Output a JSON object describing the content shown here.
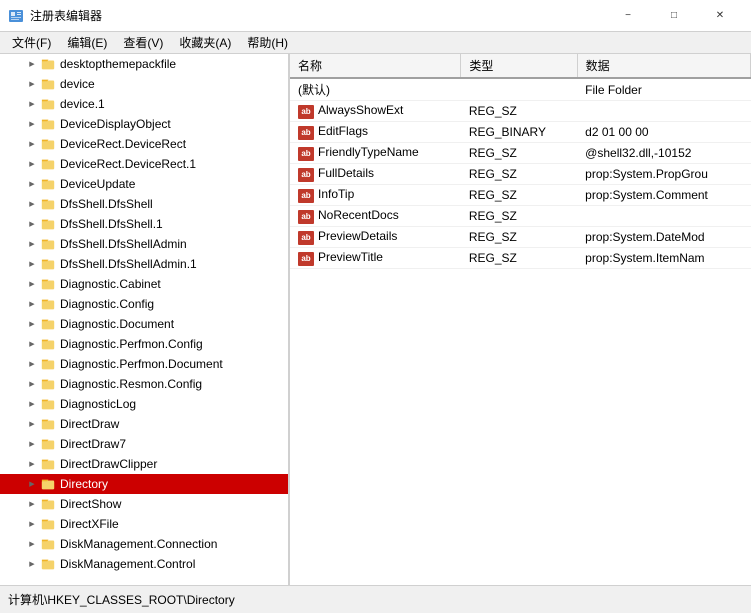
{
  "window": {
    "title": "注册表编辑器",
    "icon": "regedit-icon"
  },
  "menu": {
    "items": [
      {
        "label": "文件(F)"
      },
      {
        "label": "编辑(E)"
      },
      {
        "label": "查看(V)"
      },
      {
        "label": "收藏夹(A)"
      },
      {
        "label": "帮助(H)"
      }
    ]
  },
  "tree": {
    "items": [
      {
        "id": "desktopthemepackfile",
        "label": "desktopthemepackfile",
        "indent": 1,
        "expanded": false
      },
      {
        "id": "device",
        "label": "device",
        "indent": 1,
        "expanded": false
      },
      {
        "id": "device1",
        "label": "device.1",
        "indent": 1,
        "expanded": false
      },
      {
        "id": "devicedisplayobject",
        "label": "DeviceDisplayObject",
        "indent": 1,
        "expanded": false
      },
      {
        "id": "devicerect",
        "label": "DeviceRect.DeviceRect",
        "indent": 1,
        "expanded": false
      },
      {
        "id": "devicerect1",
        "label": "DeviceRect.DeviceRect.1",
        "indent": 1,
        "expanded": false
      },
      {
        "id": "deviceupdate",
        "label": "DeviceUpdate",
        "indent": 1,
        "expanded": false
      },
      {
        "id": "dfsshell",
        "label": "DfsShell.DfsShell",
        "indent": 1,
        "expanded": false
      },
      {
        "id": "dfsshell1",
        "label": "DfsShell.DfsShell.1",
        "indent": 1,
        "expanded": false
      },
      {
        "id": "dfsshellAdmin",
        "label": "DfsShell.DfsShellAdmin",
        "indent": 1,
        "expanded": false
      },
      {
        "id": "dfsshellAdmin1",
        "label": "DfsShell.DfsShellAdmin.1",
        "indent": 1,
        "expanded": false
      },
      {
        "id": "diagnostic_cabinet",
        "label": "Diagnostic.Cabinet",
        "indent": 1,
        "expanded": false
      },
      {
        "id": "diagnostic_config",
        "label": "Diagnostic.Config",
        "indent": 1,
        "expanded": false
      },
      {
        "id": "diagnostic_document",
        "label": "Diagnostic.Document",
        "indent": 1,
        "expanded": false
      },
      {
        "id": "diagnostic_perfmon",
        "label": "Diagnostic.Perfmon.Config",
        "indent": 1,
        "expanded": false
      },
      {
        "id": "diagnostic_perfmon_doc",
        "label": "Diagnostic.Perfmon.Document",
        "indent": 1,
        "expanded": false
      },
      {
        "id": "diagnostic_resmon",
        "label": "Diagnostic.Resmon.Config",
        "indent": 1,
        "expanded": false
      },
      {
        "id": "diagnosticlog",
        "label": "DiagnosticLog",
        "indent": 1,
        "expanded": false
      },
      {
        "id": "directdraw",
        "label": "DirectDraw",
        "indent": 1,
        "expanded": false
      },
      {
        "id": "directdraw7",
        "label": "DirectDraw7",
        "indent": 1,
        "expanded": false
      },
      {
        "id": "directdrawclipper",
        "label": "DirectDrawClipper",
        "indent": 1,
        "expanded": false
      },
      {
        "id": "directory",
        "label": "Directory",
        "indent": 1,
        "expanded": false,
        "selected": true
      },
      {
        "id": "directshow",
        "label": "DirectShow",
        "indent": 1,
        "expanded": false
      },
      {
        "id": "directxfile",
        "label": "DirectXFile",
        "indent": 1,
        "expanded": false
      },
      {
        "id": "diskmanagement_connection",
        "label": "DiskManagement.Connection",
        "indent": 1,
        "expanded": false
      },
      {
        "id": "diskmanagement_control",
        "label": "DiskManagement.Control",
        "indent": 1,
        "expanded": false
      }
    ]
  },
  "registry_table": {
    "columns": [
      {
        "label": "名称"
      },
      {
        "label": "类型"
      },
      {
        "label": "数据"
      }
    ],
    "rows": [
      {
        "name": "(默认)",
        "name_prefix": "",
        "type": "",
        "data": "File Folder",
        "icon": null
      },
      {
        "name": "AlwaysShowExt",
        "name_prefix": "ab",
        "type": "REG_SZ",
        "data": "",
        "icon": "ab"
      },
      {
        "name": "EditFlags",
        "name_prefix": "ab",
        "type": "REG_BINARY",
        "data": "d2 01 00 00",
        "icon": "ab"
      },
      {
        "name": "FriendlyTypeName",
        "name_prefix": "ab",
        "type": "REG_SZ",
        "data": "@shell32.dll,-10152",
        "icon": "ab"
      },
      {
        "name": "FullDetails",
        "name_prefix": "ab",
        "type": "REG_SZ",
        "data": "prop:System.PropGrou",
        "icon": "ab"
      },
      {
        "name": "InfoTip",
        "name_prefix": "ab",
        "type": "REG_SZ",
        "data": "prop:System.Comment",
        "icon": "ab"
      },
      {
        "name": "NoRecentDocs",
        "name_prefix": "ab",
        "type": "REG_SZ",
        "data": "",
        "icon": "ab"
      },
      {
        "name": "PreviewDetails",
        "name_prefix": "ab",
        "type": "REG_SZ",
        "data": "prop:System.DateMod",
        "icon": "ab"
      },
      {
        "name": "PreviewTitle",
        "name_prefix": "ab",
        "type": "REG_SZ",
        "data": "prop:System.ItemNam",
        "icon": "ab"
      }
    ]
  },
  "status_bar": {
    "path": "计算机\\HKEY_CLASSES_ROOT\\Directory"
  },
  "title_buttons": {
    "minimize": "−",
    "maximize": "□",
    "close": "✕"
  }
}
